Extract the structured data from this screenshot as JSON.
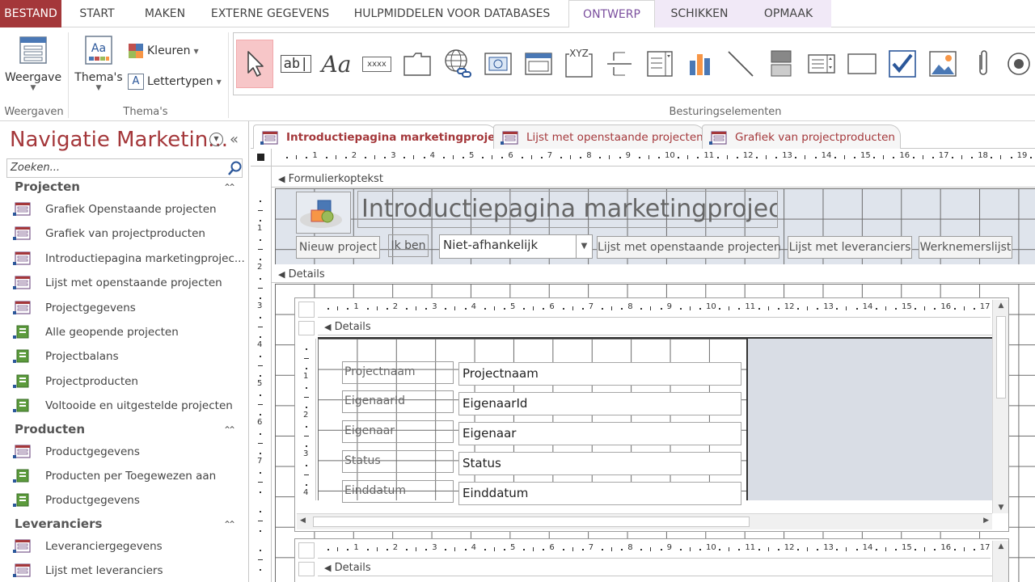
{
  "ribbon_tabs": {
    "file": "BESTAND",
    "start": "START",
    "make": "MAKEN",
    "external": "EXTERNE GEGEVENS",
    "tools": "HULPMIDDELEN VOOR DATABASES",
    "design": "ONTWERP",
    "arrange": "SCHIKKEN",
    "format": "OPMAAK"
  },
  "ribbon": {
    "views_button": "Weergave",
    "views_group": "Weergaven",
    "themes_button": "Thema's",
    "colors_button": "Kleuren",
    "fonts_button": "Lettertypen",
    "themes_group": "Thema's",
    "controls_group": "Besturingselementen",
    "textbox_glyph": "ab|",
    "label_glyph": "Aa",
    "button_glyph": "xxxx",
    "chart_glyph": "XYZ"
  },
  "nav": {
    "title": "Navigatie Marketin...",
    "search_placeholder": "Zoeken...",
    "groups": [
      {
        "name": "Projecten",
        "items": [
          {
            "label": "Grafiek Openstaande projecten",
            "icon": "form-icon"
          },
          {
            "label": "Grafiek van projectproducten",
            "icon": "form-icon"
          },
          {
            "label": "Introductiepagina marketingprojec...",
            "icon": "form-icon"
          },
          {
            "label": "Lijst met openstaande projecten",
            "icon": "form-icon"
          },
          {
            "label": "Projectgegevens",
            "icon": "form-icon"
          },
          {
            "label": "Alle geopende projecten",
            "icon": "report-icon"
          },
          {
            "label": "Projectbalans",
            "icon": "report-icon"
          },
          {
            "label": "Projectproducten",
            "icon": "report-icon"
          },
          {
            "label": "Voltooide en uitgestelde projecten",
            "icon": "report-icon"
          }
        ]
      },
      {
        "name": "Producten",
        "items": [
          {
            "label": "Productgegevens",
            "icon": "form-icon"
          },
          {
            "label": "Producten per Toegewezen aan",
            "icon": "report-icon"
          },
          {
            "label": "Productgegevens",
            "icon": "report-icon"
          }
        ]
      },
      {
        "name": "Leveranciers",
        "items": [
          {
            "label": "Leveranciergegevens",
            "icon": "form-icon"
          },
          {
            "label": "Lijst met leveranciers",
            "icon": "form-icon"
          }
        ]
      }
    ]
  },
  "doc_tabs": [
    {
      "label": "Introductiepagina marketingprojecten",
      "active": true
    },
    {
      "label": "Lijst met openstaande projecten",
      "active": false
    },
    {
      "label": "Grafiek van projectproducten",
      "active": false
    }
  ],
  "form": {
    "header_section": "Formulierkoptekst",
    "title": "Introductiepagina marketingprojecten",
    "buttons": {
      "new_project": "Nieuw project",
      "i_am": "Ik ben",
      "combo_value": "Niet-afhankelijk",
      "open_projects": "Lijst met openstaande projecten",
      "suppliers": "Lijst met leveranciers",
      "employees": "Werknemerslijst"
    },
    "details_section": "Details",
    "subform_details": "Details",
    "subform2_details": "Details",
    "fields": [
      {
        "label": "Projectnaam",
        "value": "Projectnaam"
      },
      {
        "label": "EigenaarId",
        "value": "EigenaarId"
      },
      {
        "label": "Eigenaar",
        "value": "Eigenaar"
      },
      {
        "label": "Status",
        "value": "Status"
      },
      {
        "label": "Einddatum",
        "value": "Einddatum"
      }
    ]
  },
  "ruler_numbers": [
    "1",
    "2",
    "3",
    "4",
    "5",
    "6",
    "7",
    "8",
    "9",
    "10",
    "11",
    "12",
    "13",
    "14",
    "15",
    "16",
    "17",
    "18",
    "19"
  ],
  "sub_ruler_numbers": [
    "1",
    "2",
    "3",
    "4",
    "5",
    "6",
    "7",
    "8",
    "9",
    "10",
    "11",
    "12",
    "13",
    "14",
    "15",
    "16",
    "17"
  ],
  "vruler_numbers": [
    "1",
    "2",
    "3",
    "4",
    "5",
    "6",
    "7"
  ],
  "sub_vruler_numbers": [
    "1",
    "2",
    "3",
    "4"
  ],
  "colors": {
    "accent": "#a4373a",
    "design_tab": "#7b4f9e",
    "header_bg": "#dfe4ec",
    "grid": "#6b6b6b"
  }
}
